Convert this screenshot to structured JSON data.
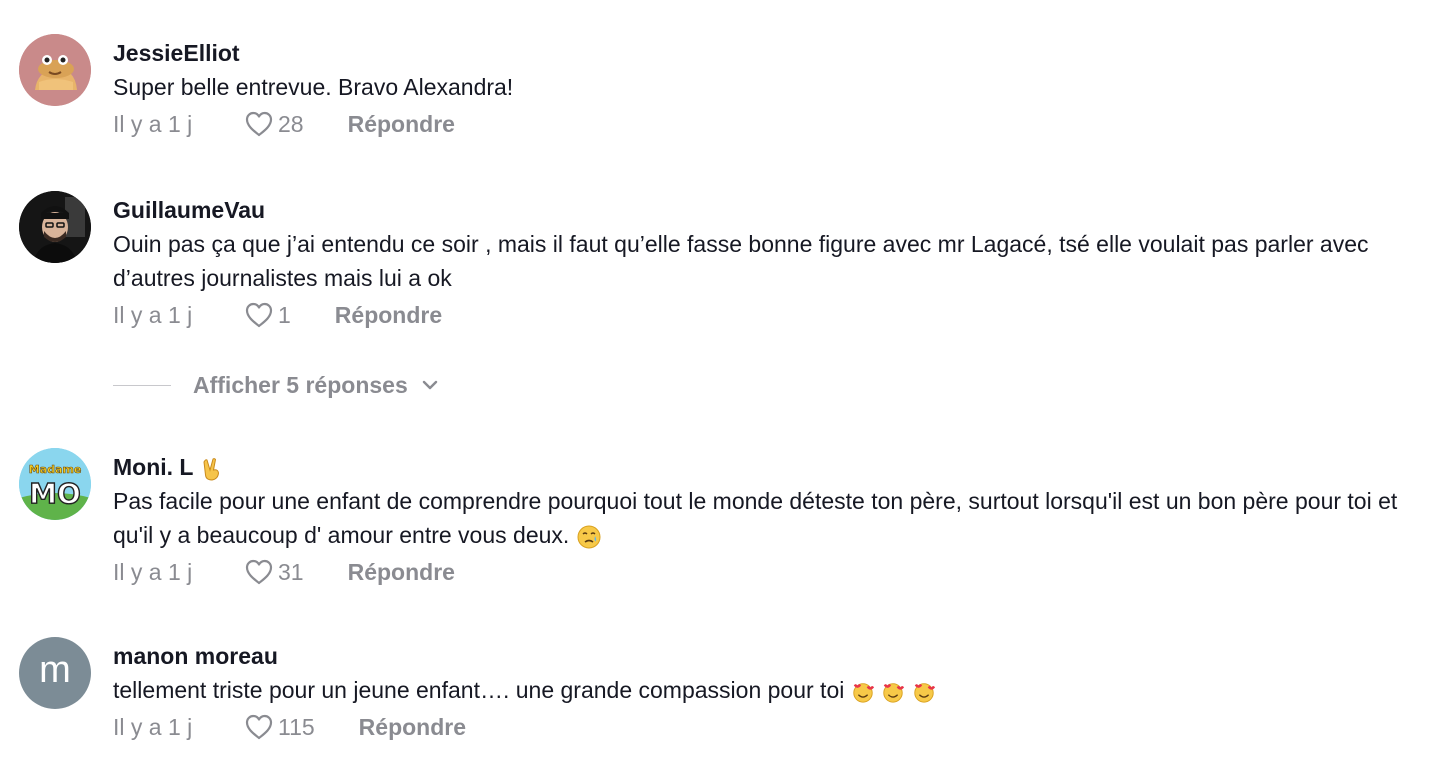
{
  "comments": [
    {
      "username": "JessieElliot",
      "text": "Super belle entrevue. Bravo Alexandra!",
      "time": "Il y a 1 j",
      "likes": "28",
      "reply_label": "Répondre",
      "avatar_icon": "cartoon-burger-avatar"
    },
    {
      "username": "GuillaumeVau",
      "text": "Ouin pas ça que j’ai entendu ce soir , mais il faut qu’elle fasse bonne figure avec mr Lagacé, tsé elle voulait pas parler avec d’autres journalistes mais lui a ok",
      "time": "Il y a 1 j",
      "likes": "1",
      "reply_label": "Répondre",
      "avatar_icon": "man-with-cap-avatar"
    },
    {
      "username": "Moni. L",
      "text": "Pas facile pour une enfant de comprendre pourquoi tout le monde déteste ton père, surtout lorsqu'il est un bon père pour toi et qu'il y a beaucoup d' amour entre vous deux.",
      "time": "Il y a 1 j",
      "likes": "31",
      "reply_label": "Répondre",
      "avatar_icon": "madame-mo-logo-avatar",
      "avatar_text_top": "Madame",
      "avatar_text_main": "MO"
    },
    {
      "username": "manon moreau",
      "text": "tellement triste pour un jeune enfant…. une grande compassion pour toi",
      "time": "Il y a 1 j",
      "likes": "115",
      "reply_label": "Répondre",
      "avatar_letter": "m"
    }
  ],
  "view_replies": {
    "label": "Afficher 5 réponses"
  },
  "colors": {
    "text": "#161823",
    "muted": "#8a8b91",
    "avatar_grey": "#7c8c96"
  }
}
